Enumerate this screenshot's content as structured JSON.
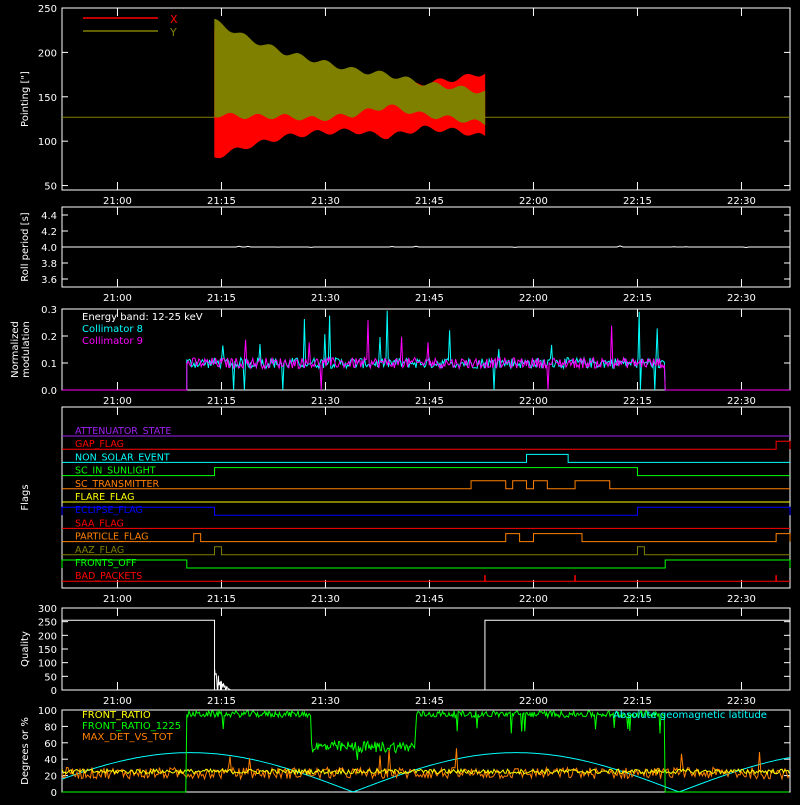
{
  "chart_data": [
    {
      "id": "pointing",
      "type": "area",
      "ylabel": "Pointing [\"]",
      "ylim": [
        45,
        250
      ],
      "xlim": [
        "20:52",
        "22:37"
      ],
      "yticks": [
        "50",
        "100",
        "150",
        "200",
        "250"
      ],
      "xticks": [
        "21:00",
        "21:15",
        "21:30",
        "21:45",
        "22:00",
        "22:15",
        "22:30"
      ],
      "legend": [
        "X",
        "Y"
      ],
      "legend_colors": [
        "#ff0000",
        "#808000"
      ],
      "baseline": 127,
      "series": [
        {
          "name": "X",
          "color": "#ff0000",
          "t_start": "21:14",
          "t_end": "21:53",
          "upper_env": [
            [
              0,
              225
            ],
            [
              5,
              190
            ],
            [
              10,
              172
            ],
            [
              15,
              168
            ],
            [
              20,
              165
            ],
            [
              25,
              160
            ],
            [
              30,
              165
            ],
            [
              35,
              170
            ],
            [
              39,
              177
            ]
          ],
          "lower_env": [
            [
              0,
              82
            ],
            [
              5,
              95
            ],
            [
              10,
              105
            ],
            [
              15,
              110
            ],
            [
              20,
              112
            ],
            [
              25,
              105
            ],
            [
              30,
              115
            ],
            [
              35,
              112
            ],
            [
              39,
              105
            ]
          ]
        },
        {
          "name": "Y",
          "color": "#808000",
          "t_start": "21:14",
          "t_end": "21:53",
          "upper_env": [
            [
              0,
              235
            ],
            [
              5,
              215
            ],
            [
              10,
              200
            ],
            [
              15,
              190
            ],
            [
              20,
              180
            ],
            [
              25,
              175
            ],
            [
              30,
              165
            ],
            [
              35,
              160
            ],
            [
              39,
              155
            ]
          ],
          "lower_env": [
            [
              0,
              130
            ],
            [
              5,
              128
            ],
            [
              10,
              128
            ],
            [
              15,
              125
            ],
            [
              20,
              130
            ],
            [
              25,
              140
            ],
            [
              30,
              130
            ],
            [
              35,
              125
            ],
            [
              39,
              120
            ]
          ]
        }
      ]
    },
    {
      "id": "roll",
      "type": "line",
      "ylabel": "Roll period [s]",
      "ylim": [
        3.5,
        4.5
      ],
      "yticks": [
        "3.6",
        "3.8",
        "4.0",
        "4.2",
        "4.4"
      ],
      "xticks": [
        "21:00",
        "21:15",
        "21:30",
        "21:45",
        "22:00",
        "22:15",
        "22:30"
      ],
      "series": [
        {
          "color": "#ffffff",
          "value": 4.0
        }
      ]
    },
    {
      "id": "modulation",
      "type": "line",
      "ylabel": "Normalized modulation",
      "ylim": [
        0,
        0.3
      ],
      "yticks": [
        "0.0",
        "0.1",
        "0.2",
        "0.3"
      ],
      "xticks": [
        "21:00",
        "21:15",
        "21:30",
        "21:45",
        "22:00",
        "22:15",
        "22:30"
      ],
      "annotations": [
        "Energy band: 12-25 keV",
        "Collimator 8",
        "Collimator 9"
      ],
      "annotation_colors": [
        "#ffffff",
        "#00ffff",
        "#ff00ff"
      ],
      "series": [
        {
          "name": "Collimator 8",
          "color": "#00ffff",
          "t_start": "21:10",
          "t_end": "22:19",
          "level": 0.1
        },
        {
          "name": "Collimator 9",
          "color": "#ff00ff",
          "t_start": "21:10",
          "t_end": "22:19",
          "level": 0.1
        }
      ]
    },
    {
      "id": "flags",
      "type": "line",
      "ylabel": "Flags",
      "xticks": [
        "21:00",
        "21:15",
        "21:30",
        "21:45",
        "22:00",
        "22:15",
        "22:30"
      ],
      "flags": [
        {
          "name": "ATTENUATOR_STATE",
          "color": "#a020f0",
          "steps": []
        },
        {
          "name": "GAP_FLAG",
          "color": "#ff0000",
          "steps": [
            [
              "22:35",
              "22:37"
            ]
          ]
        },
        {
          "name": "NON_SOLAR_EVENT",
          "color": "#00ffff",
          "steps": [
            [
              "21:59",
              "22:05"
            ]
          ]
        },
        {
          "name": "SC_IN_SUNLIGHT",
          "color": "#00ff00",
          "steps": [
            [
              "21:14",
              "22:15"
            ]
          ]
        },
        {
          "name": "SC_TRANSMITTER",
          "color": "#ff8000",
          "steps": [
            [
              "21:51",
              "21:56"
            ],
            [
              "21:57",
              "21:59"
            ],
            [
              "22:00",
              "22:02"
            ],
            [
              "22:06",
              "22:11"
            ]
          ]
        },
        {
          "name": "FLARE_FLAG",
          "color": "#ffff00",
          "steps": []
        },
        {
          "name": "ECLIPSE_FLAG",
          "color": "#0000ff",
          "steps": [
            [
              "20:52",
              "21:14"
            ],
            [
              "22:15",
              "22:37"
            ]
          ]
        },
        {
          "name": "SAA_FLAG",
          "color": "#ff0000",
          "steps": []
        },
        {
          "name": "PARTICLE_FLAG",
          "color": "#ff8000",
          "steps": [
            [
              "21:11",
              "21:12"
            ],
            [
              "21:56",
              "21:58"
            ],
            [
              "22:00",
              "22:07"
            ],
            [
              "22:35",
              "22:37"
            ]
          ]
        },
        {
          "name": "AAZ_FLAG",
          "color": "#808000",
          "steps": [
            [
              "21:14",
              "21:15"
            ],
            [
              "22:15",
              "22:16"
            ]
          ]
        },
        {
          "name": "FRONTS_OFF",
          "color": "#00ff00",
          "steps": [
            [
              "20:52",
              "21:10"
            ],
            [
              "22:19",
              "22:37"
            ]
          ]
        },
        {
          "name": "BAD_PACKETS",
          "color": "#ff0000",
          "spikes": [
            "21:53",
            "22:06",
            "22:35"
          ]
        }
      ]
    },
    {
      "id": "quality",
      "type": "line",
      "ylabel": "Quality",
      "ylim": [
        0,
        300
      ],
      "yticks": [
        "0",
        "50",
        "100",
        "150",
        "200",
        "250",
        "300"
      ],
      "xticks": [
        "21:00",
        "21:15",
        "21:30",
        "21:45",
        "22:00",
        "22:15",
        "22:30"
      ],
      "series": [
        {
          "color": "#ffffff",
          "segments": [
            [
              "20:52",
              "21:14",
              255
            ],
            [
              "21:53",
              "22:37",
              255
            ]
          ]
        }
      ]
    },
    {
      "id": "ratios",
      "type": "line",
      "ylabel": "Degrees or %",
      "ylim": [
        0,
        100
      ],
      "yticks": [
        "0",
        "20",
        "40",
        "60",
        "80",
        "100"
      ],
      "legend": [
        "FRONT_RATIO",
        "FRONT_RATIO_1225",
        "MAX_DET_VS_TOT",
        "Absolute geomagnetic latitude"
      ],
      "legend_colors": [
        "#ffff00",
        "#00ff00",
        "#ff8000",
        "#00ffff"
      ],
      "series": [
        {
          "name": "FRONT_RATIO_1225",
          "color": "#00ff00",
          "segments": [
            [
              "20:52",
              "21:10",
              0
            ],
            [
              "21:10",
              "21:28",
              95
            ],
            [
              "21:28",
              "21:43",
              55
            ],
            [
              "21:43",
              "22:19",
              95
            ],
            [
              "22:19",
              "22:37",
              0
            ]
          ]
        },
        {
          "name": "FRONT_RATIO",
          "color": "#ffff00",
          "level": 25
        },
        {
          "name": "MAX_DET_VS_TOT",
          "color": "#ff8000",
          "level": 23
        },
        {
          "name": "Absolute geomagnetic latitude",
          "color": "#00ffff",
          "period_min": 47,
          "amplitude": 48
        }
      ]
    }
  ]
}
